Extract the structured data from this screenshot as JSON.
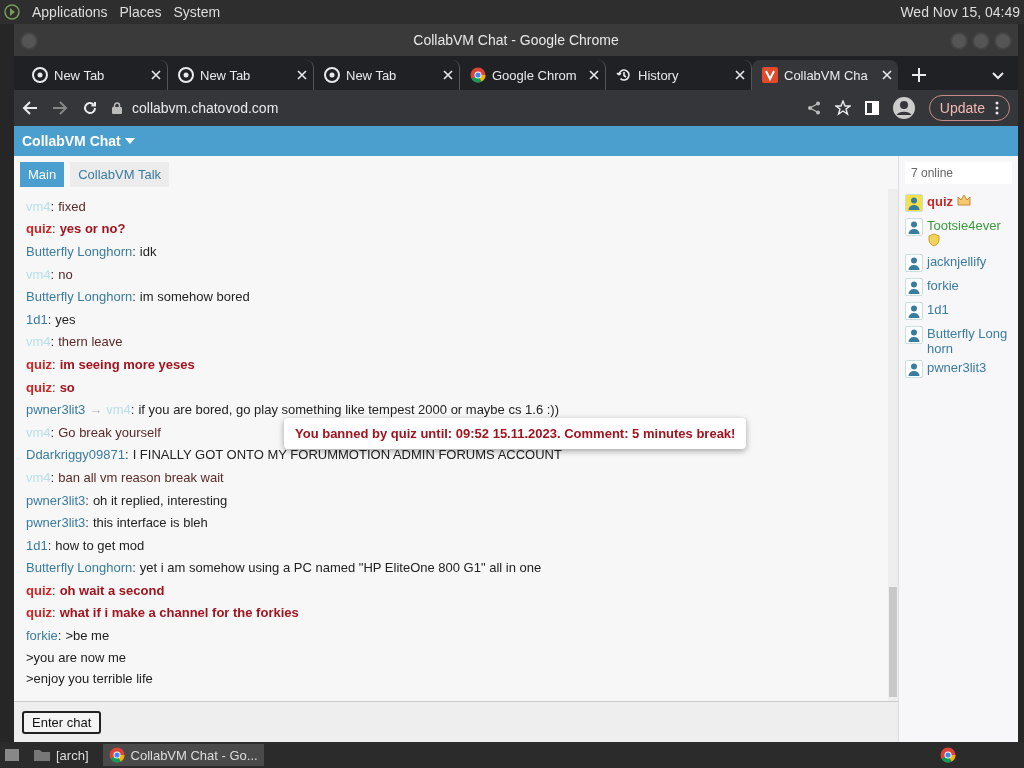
{
  "desktop_bar": {
    "menus": [
      "Applications",
      "Places",
      "System"
    ],
    "clock": "Wed Nov 15, 04:49"
  },
  "window": {
    "title": "CollabVM Chat - Google Chrome"
  },
  "tabs": [
    {
      "title": "New Tab",
      "kind": "newtab",
      "selected": false
    },
    {
      "title": "New Tab",
      "kind": "newtab",
      "selected": false
    },
    {
      "title": "New Tab",
      "kind": "newtab",
      "selected": false
    },
    {
      "title": "Google Chrom",
      "kind": "browser",
      "selected": false
    },
    {
      "title": "History",
      "kind": "history",
      "selected": false
    },
    {
      "title": "CollabVM Cha",
      "kind": "site",
      "selected": true
    }
  ],
  "toolbar": {
    "url": "collabvm.chatovod.com",
    "update_button": "Update"
  },
  "chat": {
    "title": "CollabVM Chat",
    "rooms": [
      {
        "label": "Main",
        "selected": true
      },
      {
        "label": "CollabVM Talk",
        "selected": false
      }
    ],
    "messages": [
      {
        "author": "vm4",
        "separator": ":",
        "kind": "faint",
        "text": "fixed"
      },
      {
        "author": "quiz",
        "separator": ":",
        "kind": "mod",
        "text": "yes or no?"
      },
      {
        "author": "Butterfly Longhorn",
        "separator": ":",
        "kind": "user",
        "text": "idk"
      },
      {
        "author": "vm4",
        "separator": ":",
        "kind": "faint",
        "text": "no"
      },
      {
        "author": "Butterfly Longhorn",
        "separator": ":",
        "kind": "user",
        "text": "im somehow bored"
      },
      {
        "author": "1d1",
        "separator": ":",
        "kind": "user",
        "text": "yes"
      },
      {
        "author": "vm4",
        "separator": ":",
        "kind": "faint",
        "text": "thern leave"
      },
      {
        "author": "quiz",
        "separator": ":",
        "kind": "mod",
        "text": "im seeing more yeses"
      },
      {
        "author": "quiz",
        "separator": ":",
        "kind": "mod",
        "text": "so"
      },
      {
        "author": "pwner3lit3",
        "separator": ":",
        "kind": "user",
        "arrow": "→",
        "target": "vm4",
        "text": "if you are bored, go play something like tempest 2000 or maybe cs 1.6 :))"
      },
      {
        "author": "vm4",
        "separator": ":",
        "kind": "faint",
        "text": "Go break yourself"
      },
      {
        "author": "Ddarkriggy09871",
        "separator": ":",
        "kind": "user",
        "text": "I FINALLY GOT ONTO MY FORUMMOTION ADMIN FORUMS ACCOUNT"
      },
      {
        "author": "vm4",
        "separator": ":",
        "kind": "faint",
        "text": "ban all vm reason break wait"
      },
      {
        "author": "pwner3lit3",
        "separator": ":",
        "kind": "user",
        "text": "oh it replied, interesting"
      },
      {
        "author": "pwner3lit3",
        "separator": ":",
        "kind": "user",
        "text": "this interface is bleh"
      },
      {
        "author": "1d1",
        "separator": ":",
        "kind": "user",
        "text": "how to get mod"
      },
      {
        "author": "Butterfly Longhorn",
        "separator": ":",
        "kind": "user",
        "text": "yet i am somehow using a PC named \"HP EliteOne 800 G1\" all in one"
      },
      {
        "author": "quiz",
        "separator": ":",
        "kind": "mod",
        "text": "oh wait a second"
      },
      {
        "author": "quiz",
        "separator": ":",
        "kind": "mod",
        "text": "what if i make a channel for the forkies"
      },
      {
        "author": "forkie",
        "separator": ":",
        "kind": "user",
        "text": ">be me"
      },
      {
        "kind": "continuation",
        "text": ">you are now me"
      },
      {
        "kind": "continuation",
        "text": ">enjoy you terrible life"
      }
    ],
    "notice": "You banned by quiz until: 09:52 15.11.2023. Comment: 5 minutes break!",
    "enter_button": "Enter chat",
    "online_count": "7 online",
    "users": [
      {
        "name": "quiz",
        "kind": "mod"
      },
      {
        "name": "Tootsie4ever",
        "kind": "moderator"
      },
      {
        "name": "jacknjellify",
        "kind": "user"
      },
      {
        "name": "forkie",
        "kind": "user"
      },
      {
        "name": "1d1",
        "kind": "user"
      },
      {
        "name": "Butterfly Longhorn",
        "kind": "user"
      },
      {
        "name": "pwner3lit3",
        "kind": "user"
      }
    ]
  },
  "taskbar": {
    "items": [
      "[arch]",
      "CollabVM Chat - Go..."
    ]
  }
}
